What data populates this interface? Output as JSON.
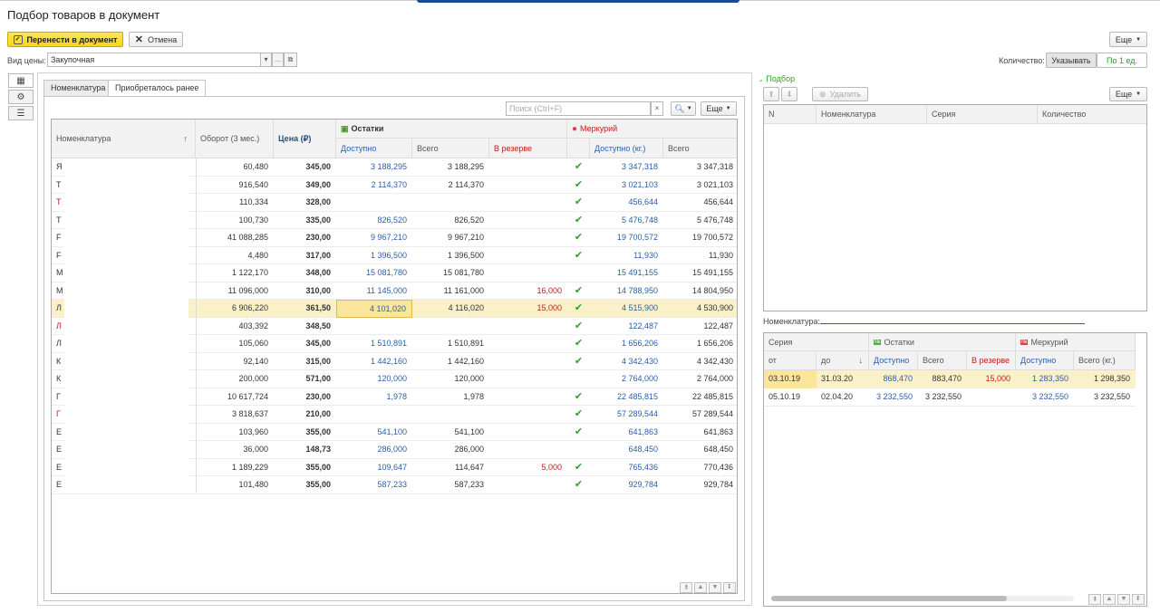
{
  "window": {
    "title": "Подбор товаров в документ"
  },
  "toolbar": {
    "transfer_label": "Перенести в документ",
    "cancel_label": "Отмена",
    "more_label": "Еще"
  },
  "price_type": {
    "label": "Вид цены:",
    "value": "Закупочная"
  },
  "quantity": {
    "label": "Количество:",
    "option_specify": "Указывать",
    "option_one": "По 1 ед."
  },
  "tabs": [
    {
      "label": "Номенклатура"
    },
    {
      "label": "Приобреталось ранее"
    }
  ],
  "search": {
    "placeholder": "Поиск (Ctrl+F)",
    "clear": "×",
    "more_label": "Еще"
  },
  "main_table": {
    "headers": {
      "nomenclature": "Номенклатура",
      "sort": "↑",
      "turnover": "Оборот (3 мес.)",
      "price": "Цена (₽)",
      "stock_group": "Остатки",
      "available": "Доступно",
      "total": "Всего",
      "reserved": "В резерве",
      "mercury_group": "Меркурий",
      "available_kg": "Доступно (кг.)",
      "total_kg": "Всего"
    },
    "rows": [
      {
        "name": "Я",
        "turnover": "60,480",
        "price": "345,00",
        "available": "3 188,295",
        "total": "3 188,295",
        "reserved": "",
        "check": "✔",
        "avail_kg": "3 347,318",
        "total_kg": "3 347,318",
        "red": false
      },
      {
        "name": "Т",
        "turnover": "916,540",
        "price": "349,00",
        "available": "2 114,370",
        "total": "2 114,370",
        "reserved": "",
        "check": "✔",
        "avail_kg": "3 021,103",
        "total_kg": "3 021,103",
        "red": false
      },
      {
        "name": "Т",
        "turnover": "110,334",
        "price": "328,00",
        "available": "",
        "total": "",
        "reserved": "",
        "check": "✔",
        "avail_kg": "456,644",
        "total_kg": "456,644",
        "red": true
      },
      {
        "name": "Т",
        "turnover": "100,730",
        "price": "335,00",
        "available": "826,520",
        "total": "826,520",
        "reserved": "",
        "check": "✔",
        "avail_kg": "5 476,748",
        "total_kg": "5 476,748",
        "red": false
      },
      {
        "name": "F",
        "turnover": "41 088,285",
        "price": "230,00",
        "available": "9 967,210",
        "total": "9 967,210",
        "reserved": "",
        "check": "✔",
        "avail_kg": "19 700,572",
        "total_kg": "19 700,572",
        "red": false
      },
      {
        "name": "F",
        "turnover": "4,480",
        "price": "317,00",
        "available": "1 396,500",
        "total": "1 396,500",
        "reserved": "",
        "check": "✔",
        "avail_kg": "11,930",
        "total_kg": "11,930",
        "red": false
      },
      {
        "name": "М",
        "turnover": "1 122,170",
        "price": "348,00",
        "available": "15 081,780",
        "total": "15 081,780",
        "reserved": "",
        "check": "",
        "avail_kg": "15 491,155",
        "total_kg": "15 491,155",
        "red": false
      },
      {
        "name": "М",
        "turnover": "11 096,000",
        "price": "310,00",
        "available": "11 145,000",
        "total": "11 161,000",
        "reserved": "16,000",
        "check": "✔",
        "avail_kg": "14 788,950",
        "total_kg": "14 804,950",
        "red": false
      },
      {
        "name": "Л",
        "turnover": "6 906,220",
        "price": "361,50",
        "available": "4 101,020",
        "total": "4 116,020",
        "reserved": "15,000",
        "check": "✔",
        "avail_kg": "4 515,900",
        "total_kg": "4 530,900",
        "red": false,
        "selected": true
      },
      {
        "name": "Л",
        "turnover": "403,392",
        "price": "348,50",
        "available": "",
        "total": "",
        "reserved": "",
        "check": "✔",
        "avail_kg": "122,487",
        "total_kg": "122,487",
        "red": true
      },
      {
        "name": "Л",
        "turnover": "105,060",
        "price": "345,00",
        "available": "1 510,891",
        "total": "1 510,891",
        "reserved": "",
        "check": "✔",
        "avail_kg": "1 656,206",
        "total_kg": "1 656,206",
        "red": false
      },
      {
        "name": "К",
        "turnover": "92,140",
        "price": "315,00",
        "available": "1 442,160",
        "total": "1 442,160",
        "reserved": "",
        "check": "✔",
        "avail_kg": "4 342,430",
        "total_kg": "4 342,430",
        "red": false
      },
      {
        "name": "К",
        "turnover": "200,000",
        "price": "571,00",
        "available": "120,000",
        "total": "120,000",
        "reserved": "",
        "check": "",
        "avail_kg": "2 764,000",
        "total_kg": "2 764,000",
        "red": false
      },
      {
        "name": "Г",
        "turnover": "10 617,724",
        "price": "230,00",
        "available": "1,978",
        "total": "1,978",
        "reserved": "",
        "check": "✔",
        "avail_kg": "22 485,815",
        "total_kg": "22 485,815",
        "red": false
      },
      {
        "name": "Г",
        "turnover": "3 818,637",
        "price": "210,00",
        "available": "",
        "total": "",
        "reserved": "",
        "check": "✔",
        "avail_kg": "57 289,544",
        "total_kg": "57 289,544",
        "red": true
      },
      {
        "name": "Е",
        "turnover": "103,960",
        "price": "355,00",
        "available": "541,100",
        "total": "541,100",
        "reserved": "",
        "check": "✔",
        "avail_kg": "641,863",
        "total_kg": "641,863",
        "red": false
      },
      {
        "name": "Е",
        "turnover": "36,000",
        "price": "148,73",
        "available": "286,000",
        "total": "286,000",
        "reserved": "",
        "check": "",
        "avail_kg": "648,450",
        "total_kg": "648,450",
        "red": false
      },
      {
        "name": "Е",
        "turnover": "1 189,229",
        "price": "355,00",
        "available": "109,647",
        "total": "114,647",
        "reserved": "5,000",
        "check": "✔",
        "avail_kg": "765,436",
        "total_kg": "770,436",
        "red": false
      },
      {
        "name": "Е",
        "turnover": "101,480",
        "price": "355,00",
        "available": "587,233",
        "total": "587,233",
        "reserved": "",
        "check": "✔",
        "avail_kg": "929,784",
        "total_kg": "929,784",
        "red": false
      }
    ]
  },
  "selection": {
    "title": "Подбор",
    "delete_label": "Удалить",
    "more_label": "Еще",
    "headers": {
      "n": "N",
      "nomenclature": "Номенклатура",
      "series": "Серия",
      "quantity": "Количество"
    }
  },
  "series_panel": {
    "label": "Номенклатура:",
    "headers": {
      "series": "Серия",
      "from": "от",
      "to": "до",
      "sort": "↓",
      "stock_group": "Остатки",
      "mercury_group": "Меркурий",
      "available": "Доступно",
      "total": "Всего",
      "reserved": "В резерве",
      "m_available": "Доступно",
      "total_kg": "Всего (кг.)"
    },
    "rows": [
      {
        "from": "03.10.19",
        "to": "31.03.20",
        "available": "868,470",
        "total": "883,470",
        "reserved": "15,000",
        "m_available": "1 283,350",
        "total_kg": "1 298,350",
        "selected": true
      },
      {
        "from": "05.10.19",
        "to": "02.04.20",
        "available": "3 232,550",
        "total": "3 232,550",
        "reserved": "",
        "m_available": "3 232,550",
        "total_kg": "3 232,550"
      }
    ]
  },
  "colors": {
    "accent_yellow": "#f7d51b",
    "link_blue": "#2a5ea8",
    "red": "#c41c1c",
    "green_check": "#27a327",
    "selection": "#fbf1c8"
  },
  "icons": [
    "grid-icon",
    "gear-icon",
    "list-icon",
    "search-icon",
    "chevron-down-icon",
    "check-icon",
    "close-icon"
  ]
}
